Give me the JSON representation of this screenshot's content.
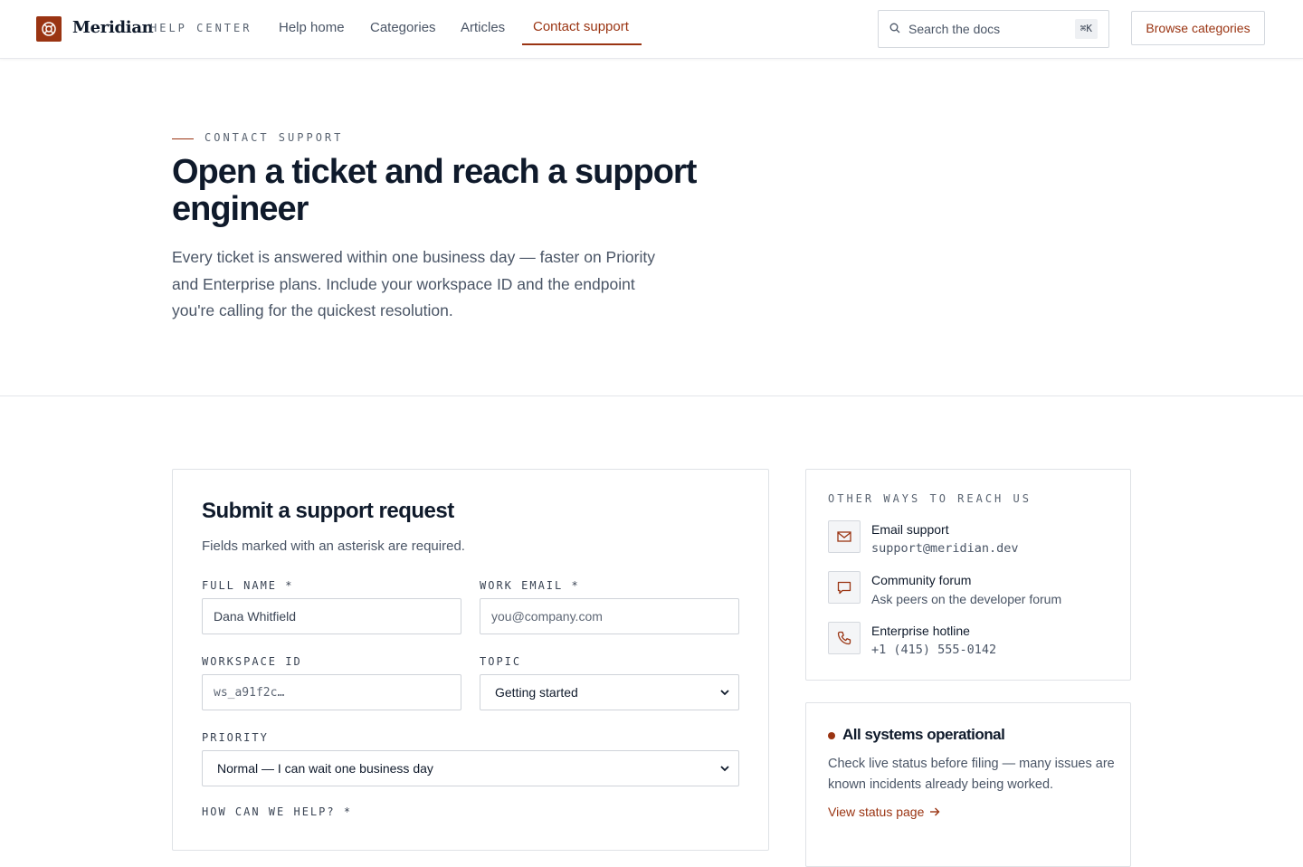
{
  "brand": {
    "name": "Meridian",
    "section": "HELP CENTER"
  },
  "nav": {
    "items": [
      "Help home",
      "Categories",
      "Articles",
      "Contact support"
    ],
    "active": "Contact support"
  },
  "search": {
    "placeholder": "Search the docs",
    "shortcut": "⌘K"
  },
  "header_button": "Browse categories",
  "hero": {
    "eyebrow": "CONTACT SUPPORT",
    "title": "Open a ticket and reach a support engineer",
    "description": "Every ticket is answered within one business day — faster on Priority and Enterprise plans. Include your workspace ID and the endpoint you're calling for the quickest resolution."
  },
  "form": {
    "title": "Submit a support request",
    "subtitle": "Fields marked with an asterisk are required.",
    "full_name": {
      "label": "FULL NAME *",
      "value": "Dana Whitfield"
    },
    "work_email": {
      "label": "WORK EMAIL *",
      "placeholder": "you@company.com"
    },
    "workspace_id": {
      "label": "WORKSPACE ID",
      "placeholder": "ws_a91f2c…"
    },
    "topic": {
      "label": "TOPIC",
      "value": "Getting started"
    },
    "priority": {
      "label": "PRIORITY",
      "value": "Normal — I can wait one business day"
    },
    "message": {
      "label": "HOW CAN WE HELP? *"
    }
  },
  "other_ways": {
    "title": "OTHER WAYS TO REACH US",
    "items": [
      {
        "icon": "mail-icon",
        "label": "Email support",
        "value": "support@meridian.dev"
      },
      {
        "icon": "chat-icon",
        "label": "Community forum",
        "value": "Ask peers on the developer forum"
      },
      {
        "icon": "phone-icon",
        "label": "Enterprise hotline",
        "value": "+1 (415) 555-0142"
      }
    ]
  },
  "status": {
    "title": "All systems operational",
    "text": "Check live status before filing — many issues are known incidents already being worked.",
    "link": "View status page"
  },
  "colors": {
    "accent": "#9a3412",
    "ink": "#0f1a2b",
    "muted": "#4a5566",
    "border": "#dfe2e6"
  }
}
